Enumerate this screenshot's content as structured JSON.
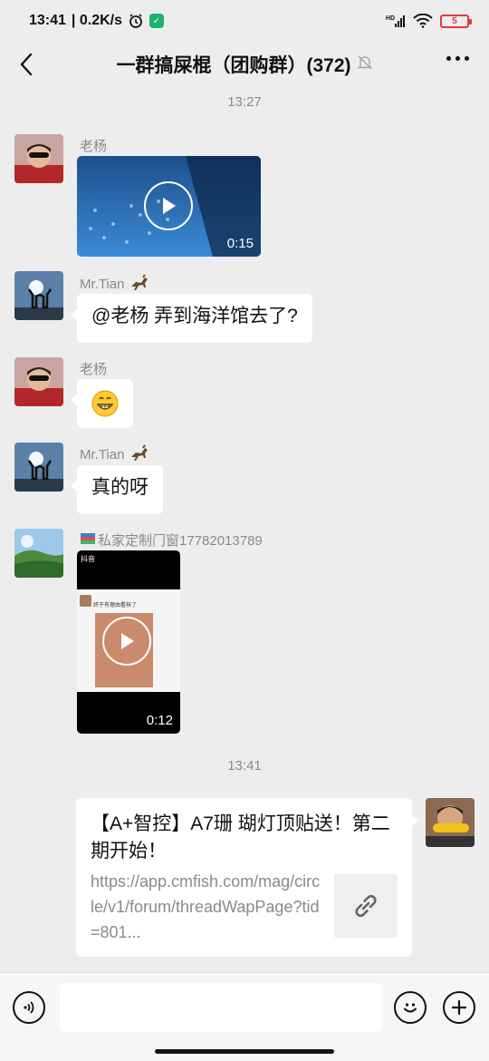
{
  "status": {
    "time": "13:41",
    "speed": "| 0.2K/s",
    "battery": "5",
    "signal_label": "HD"
  },
  "header": {
    "title": "一群搞屎棍（团购群）(372)"
  },
  "timestamps": [
    "13:27",
    "13:41"
  ],
  "messages": {
    "m1": {
      "sender": "老杨",
      "video_duration": "0:15"
    },
    "m2": {
      "sender": "Mr.Tian",
      "text": "@老杨  弄到海洋馆去了?"
    },
    "m3": {
      "sender": "老杨",
      "emoji": "grinning-face"
    },
    "m4": {
      "sender": "Mr.Tian",
      "text": "真的呀"
    },
    "m5": {
      "sender": "私家定制门窗17782013789",
      "video_duration": "0:12",
      "thumb_top": "抖音",
      "thumb_caption": "终于有理由看核了"
    },
    "m6": {
      "link_title": "【A+智控】A7珊 瑚灯顶贴送！第二期开始！",
      "link_desc": "https://app.cmfish.com/mag/circle/v1/forum/threadWapPage?tid=801..."
    }
  },
  "colors": {
    "background": "#ededed",
    "bubble": "#ffffff",
    "muted_text": "#8a8a8a",
    "battery_low": "#e23b3b"
  },
  "icons": [
    "back-icon",
    "mute-bell-icon",
    "more-icon",
    "play-icon",
    "link-icon",
    "voice-icon",
    "emoji-icon",
    "add-icon",
    "horse-emoji-icon"
  ]
}
